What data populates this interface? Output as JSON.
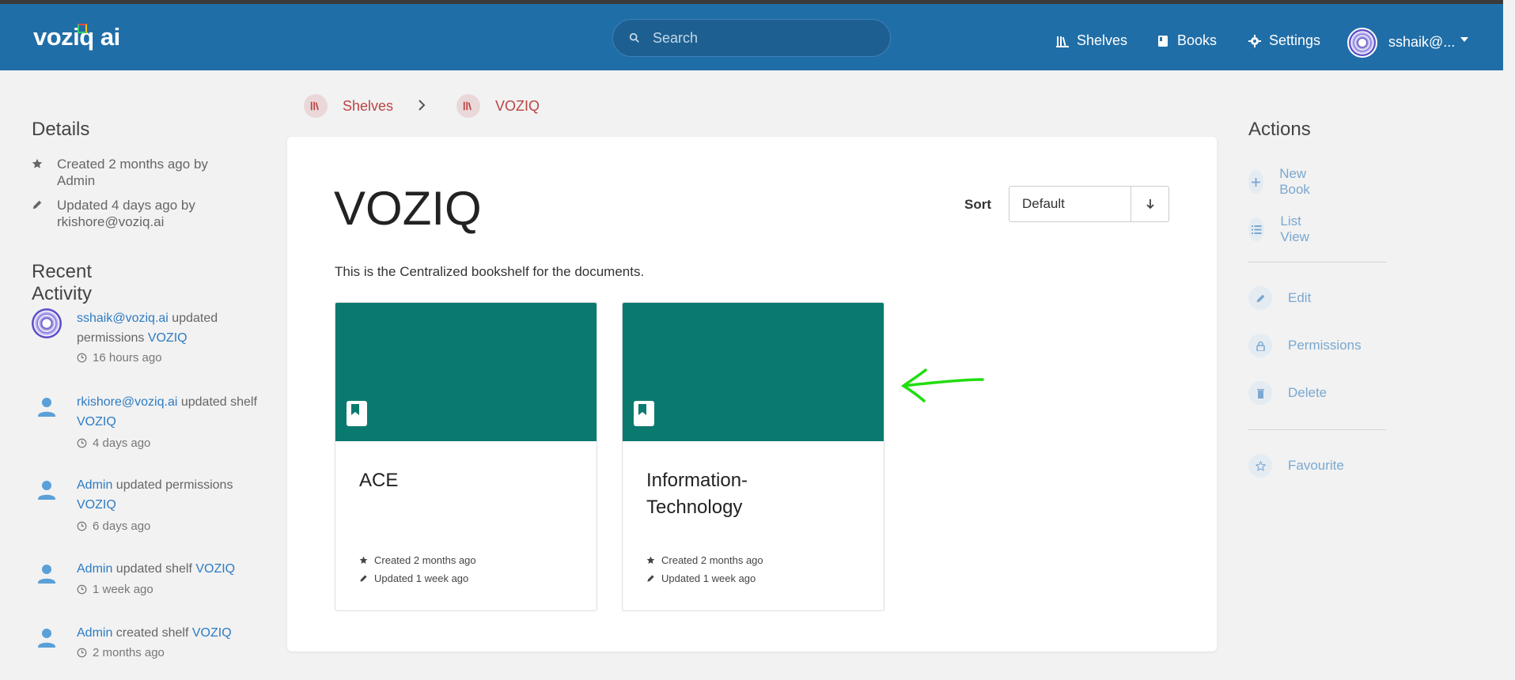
{
  "header": {
    "logo": "voziq ai",
    "search_placeholder": "Search",
    "nav": [
      {
        "label": "Shelves",
        "icon": "shelves-icon"
      },
      {
        "label": "Books",
        "icon": "book-icon"
      },
      {
        "label": "Settings",
        "icon": "gear-icon"
      }
    ],
    "user": "sshaik@..."
  },
  "details": {
    "title": "Details",
    "created": "Created 2 months ago by Admin",
    "updated": "Updated 4 days ago by rkishore@voziq.ai"
  },
  "activity": {
    "title": "Recent Activity",
    "items": [
      {
        "user": "sshaik@voziq.ai",
        "action": " updated permissions ",
        "target": "VOZIQ",
        "time": "16 hours ago"
      },
      {
        "user": "rkishore@voziq.ai",
        "action": " updated shelf ",
        "target": "VOZIQ",
        "time": "4 days ago"
      },
      {
        "user": "Admin",
        "action": " updated permissions ",
        "target": "VOZIQ",
        "time": "6 days ago"
      },
      {
        "user": "Admin",
        "action": " updated shelf ",
        "target": "VOZIQ",
        "time": "1 week ago"
      },
      {
        "user": "Admin",
        "action": " created shelf ",
        "target": "VOZIQ",
        "time": "2 months ago"
      }
    ]
  },
  "breadcrumb": {
    "root": "Shelves",
    "current": "VOZIQ"
  },
  "shelf": {
    "title": "VOZIQ",
    "sort_label": "Sort",
    "sort_value": "Default",
    "description": "This is the Centralized bookshelf for the documents.",
    "books": [
      {
        "name": "ACE",
        "created": "Created 2 months ago",
        "updated": "Updated 1 week ago"
      },
      {
        "name": "Information-Technology",
        "display_name": "Information-\nTechnology",
        "created": "Created 2 months ago",
        "updated": "Updated 1 week ago"
      }
    ],
    "cover_color": "#0b7a6e"
  },
  "actions": {
    "title": "Actions",
    "items": [
      "New Book",
      "List View",
      "Edit",
      "Permissions",
      "Delete",
      "Favourite"
    ]
  },
  "colors": {
    "header": "#206ea7",
    "link": "#2e7bc2",
    "action": "#7aa8d0",
    "annotation_arrow": "#22dd11"
  }
}
